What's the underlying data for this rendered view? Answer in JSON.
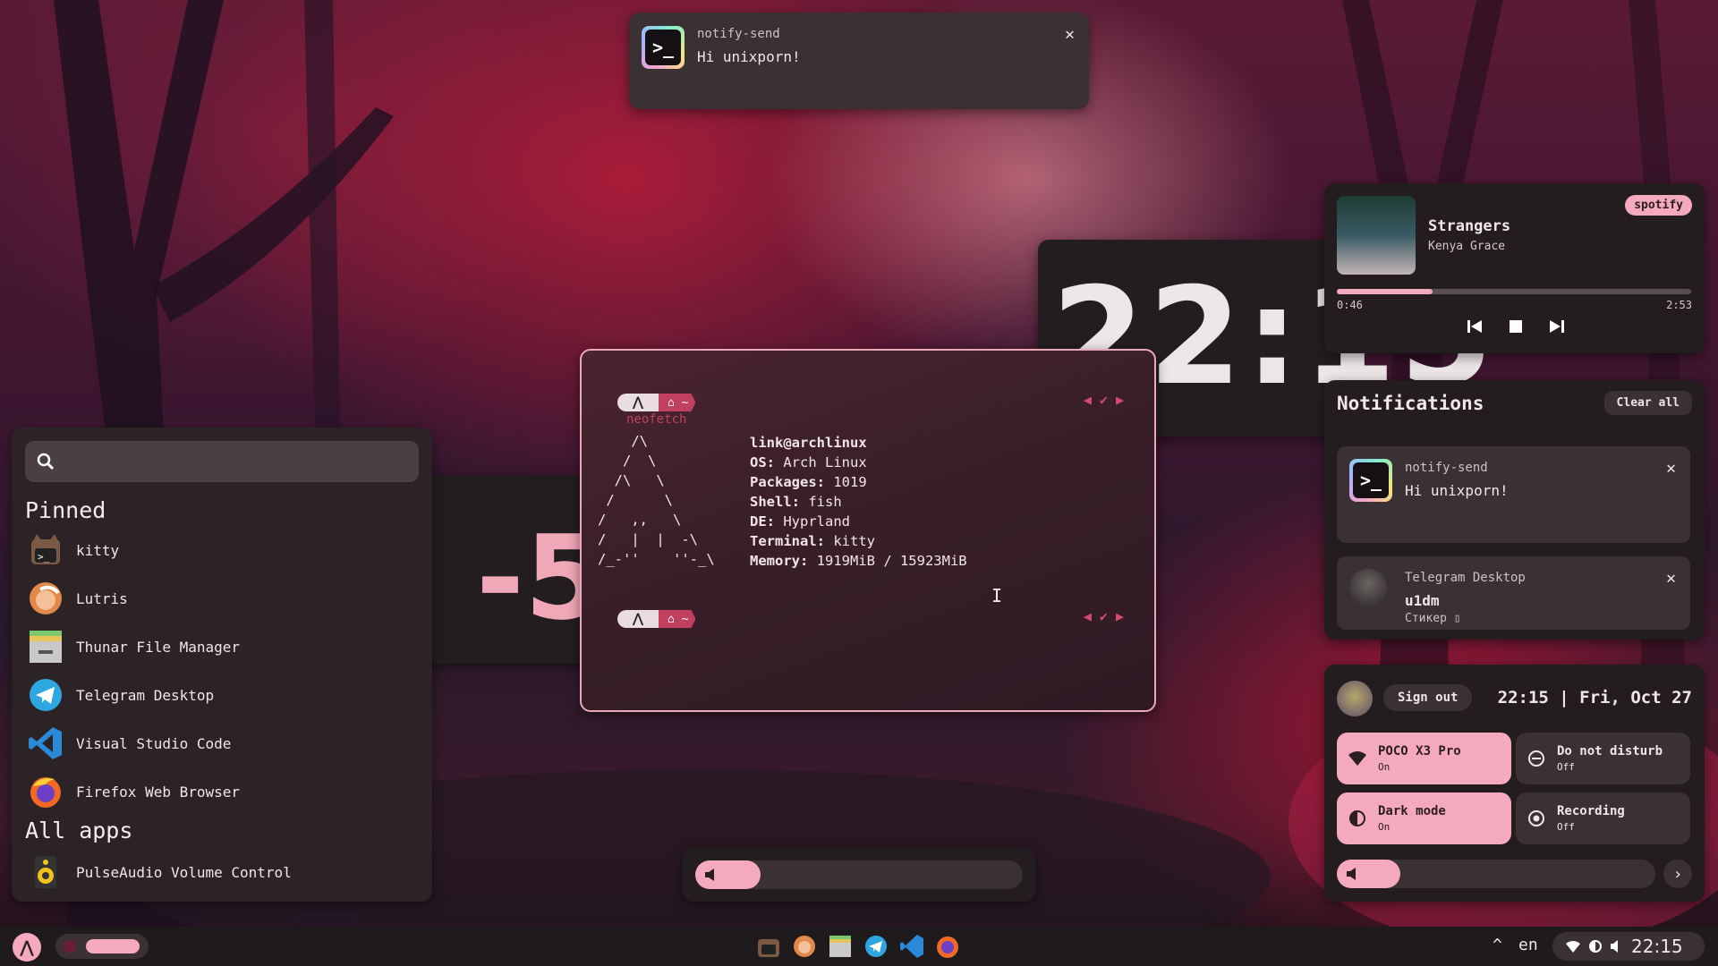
{
  "toast": {
    "app": "notify-send",
    "body": "Hi unixporn!"
  },
  "clock": {
    "time": "22:15",
    "date_fragment": "-5"
  },
  "launcher": {
    "search_placeholder": "",
    "pinned_label": "Pinned",
    "pinned": [
      "kitty",
      "Lutris",
      "Thunar File Manager",
      "Telegram Desktop",
      "Visual Studio Code",
      "Firefox Web Browser"
    ],
    "all_label": "All apps",
    "all": [
      "PulseAudio Volume Control"
    ]
  },
  "terminal": {
    "command": "neofetch",
    "prompt_dir": "~",
    "ascii": "    /\\\n   /  \\\n  /\\   \\\n /      \\\n/   ,,   \\\n/   |  |  -\\\n/_-''    ''-_\\",
    "info": [
      {
        "key": "link@archlinux",
        "value": ""
      },
      {
        "key": "OS:",
        "value": " Arch Linux"
      },
      {
        "key": "Packages:",
        "value": " 1019"
      },
      {
        "key": "Shell:",
        "value": " fish"
      },
      {
        "key": "DE:",
        "value": " Hyprland"
      },
      {
        "key": "Terminal:",
        "value": " kitty"
      },
      {
        "key": "Memory:",
        "value": " 1919MiB / 15923MiB"
      }
    ],
    "ascii_lines": [
      "    /\\",
      "   /  \\",
      "  /\\   \\",
      " /      \\",
      "/   ,,   \\",
      "/   |  |  -\\",
      "/_-''    ''-_\\"
    ]
  },
  "media": {
    "source": "spotify",
    "title": "Strangers",
    "artist": "Kenya Grace",
    "elapsed": "0:46",
    "duration": "2:53",
    "progress": 0.27
  },
  "notifications": {
    "title": "Notifications",
    "clear_label": "Clear all",
    "items": [
      {
        "app": "notify-send",
        "title": "Hi unixporn!",
        "body": ""
      },
      {
        "app": "Telegram Desktop",
        "title": "u1dm",
        "body": "Стикер"
      }
    ]
  },
  "quick": {
    "signout_label": "Sign out",
    "time": "22:15",
    "date": "Fri, Oct 27",
    "tiles": [
      {
        "label": "POCO X3 Pro",
        "state": "On"
      },
      {
        "label": "Do not disturb",
        "state": "Off"
      },
      {
        "label": "Dark mode",
        "state": "On"
      },
      {
        "label": "Recording",
        "state": "Off"
      }
    ],
    "volume": 0.2
  },
  "osd": {
    "volume": 0.2
  },
  "taskbar": {
    "lang": "en",
    "time": "22:15"
  },
  "colors": {
    "accent": "#f4a9bd",
    "panel": "#231d20",
    "card": "#3b3033",
    "terminal_border": "#e9a9b8",
    "prompt": "#c2405f"
  }
}
